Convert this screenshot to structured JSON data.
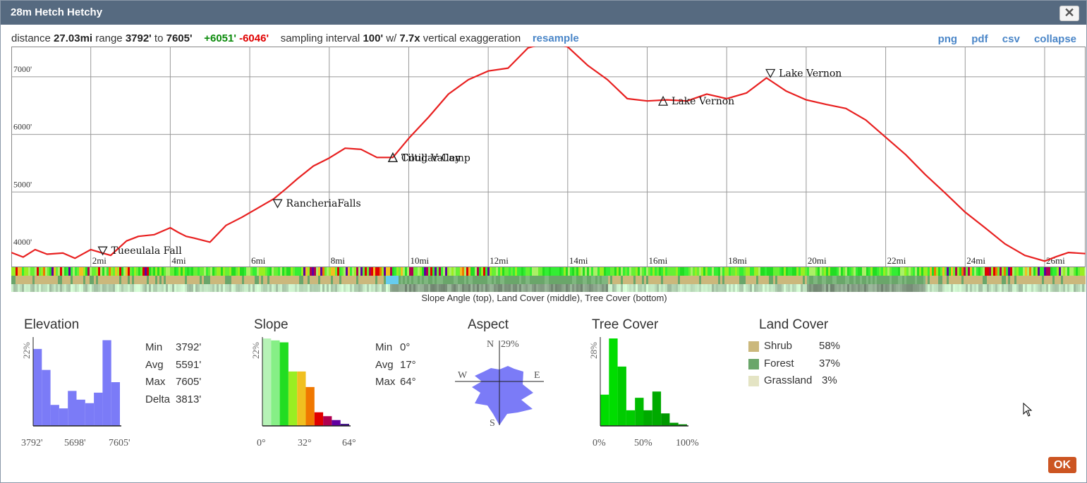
{
  "window": {
    "title": "28m Hetch Hetchy",
    "close_label": "✕"
  },
  "info": {
    "distance_label": "distance",
    "distance": "27.03mi",
    "range_label": "range",
    "range_min": "3792'",
    "to_label": "to",
    "range_max": "7605'",
    "gain": "+6051'",
    "loss": "-6046'",
    "sampling_label": "sampling interval",
    "interval": "100'",
    "w_label": "w/",
    "exaggeration": "7.7x",
    "exaggeration_label": "vertical exaggeration",
    "resample": "resample"
  },
  "links": [
    "png",
    "pdf",
    "csv",
    "collapse"
  ],
  "profile": {
    "y_ticks": [
      "4000'",
      "5000'",
      "6000'",
      "7000'"
    ],
    "x_ticks": [
      "2mi",
      "4mi",
      "6mi",
      "8mi",
      "10mi",
      "12mi",
      "14mi",
      "16mi",
      "18mi",
      "20mi",
      "22mi",
      "24mi",
      "26mi"
    ],
    "line_color": "#e82020",
    "caption": "Slope Angle (top), Land Cover (middle), Tree Cover (bottom)"
  },
  "chart_data": [
    {
      "type": "line",
      "title": "",
      "xlabel": "",
      "ylabel": "",
      "xlim": [
        0,
        27.03
      ],
      "ylim": [
        3792,
        7605
      ],
      "x": [
        0,
        0.3,
        0.6,
        0.9,
        1.3,
        1.6,
        2.0,
        2.2,
        2.5,
        2.9,
        3.2,
        3.6,
        4.0,
        4.2,
        4.4,
        4.6,
        5.0,
        5.4,
        5.8,
        6.2,
        6.6,
        6.9,
        7.2,
        7.6,
        8.0,
        8.4,
        8.8,
        9.2,
        9.6,
        10.0,
        10.5,
        11.0,
        11.5,
        12.0,
        12.5,
        13.0,
        13.5,
        14.0,
        14.5,
        15.0,
        15.5,
        16.0,
        16.5,
        17.0,
        17.5,
        18.0,
        18.5,
        19.0,
        19.5,
        20.0,
        20.5,
        21.0,
        21.5,
        22.0,
        22.5,
        23.0,
        23.5,
        24.0,
        24.5,
        25.0,
        25.5,
        26.0,
        26.3,
        26.6,
        27.03
      ],
      "y": [
        3950,
        3870,
        4000,
        3920,
        3940,
        3850,
        4000,
        3960,
        3900,
        4150,
        4230,
        4260,
        4380,
        4300,
        4230,
        4200,
        4130,
        4420,
        4560,
        4720,
        4880,
        5050,
        5230,
        5450,
        5590,
        5760,
        5740,
        5600,
        5600,
        5930,
        6300,
        6700,
        6950,
        7100,
        7150,
        7500,
        7600,
        7520,
        7200,
        6950,
        6620,
        6580,
        6600,
        6580,
        6700,
        6620,
        6720,
        6980,
        6750,
        6600,
        6520,
        6450,
        6250,
        5950,
        5650,
        5300,
        4980,
        4650,
        4380,
        4100,
        3900,
        3800,
        3880,
        3950,
        3930
      ]
    },
    {
      "type": "bar",
      "title": "Elevation",
      "categories": [
        "3792'",
        "",
        "",
        "",
        "5698'",
        "",
        "",
        "",
        "",
        "7605'"
      ],
      "values": [
        0.22,
        0.16,
        0.06,
        0.05,
        0.1,
        0.075,
        0.065,
        0.095,
        0.245,
        0.125
      ],
      "ylabel": "22%",
      "ylim": [
        0,
        0.25
      ],
      "color": "#7b7bf7"
    },
    {
      "type": "bar",
      "title": "Slope",
      "categories": [
        "0°",
        "",
        "",
        "",
        "32°",
        "",
        "",
        "",
        "",
        "64°"
      ],
      "values": [
        0.225,
        0.22,
        0.215,
        0.14,
        0.14,
        0.1,
        0.035,
        0.025,
        0.015,
        0.005
      ],
      "colors": [
        "#b6f2b6",
        "#86ef86",
        "#22dd22",
        "#99ee22",
        "#f0c020",
        "#f07800",
        "#e00000",
        "#b00050",
        "#6000a0",
        "#30007a"
      ],
      "ylabel": "22%",
      "ylim": [
        0,
        0.225
      ]
    },
    {
      "type": "bar",
      "title": "Tree Cover",
      "categories": [
        "0%",
        "",
        "",
        "",
        "50%",
        "",
        "",
        "",
        "",
        "100%"
      ],
      "values": [
        0.1,
        0.28,
        0.19,
        0.05,
        0.09,
        0.05,
        0.11,
        0.04,
        0.01,
        0.005
      ],
      "colors": [
        "#00dd00",
        "#00dd00",
        "#00cc00",
        "#00cc00",
        "#00bb00",
        "#00aa00",
        "#00aa00",
        "#009900",
        "#009900",
        "#008800"
      ],
      "ylabel": "28%",
      "ylim": [
        0,
        0.28
      ]
    }
  ],
  "profile_labels": [
    {
      "text": "Tueeulala Fall",
      "dir": "down"
    },
    {
      "text": "RancheriaFalls",
      "dir": "down"
    },
    {
      "text": "Tiltill Valley",
      "dir": "up"
    },
    {
      "text": "Cougar Camp",
      "dir": "up"
    },
    {
      "text": "Lake Vernon",
      "dir": "up"
    },
    {
      "text": "Lake Vernon",
      "dir": "down"
    }
  ],
  "elevation": {
    "title": "Elevation",
    "stats": [
      {
        "k": "Min",
        "v": "3792'"
      },
      {
        "k": "Avg",
        "v": "5591'"
      },
      {
        "k": "Max",
        "v": "7605'"
      },
      {
        "k": "Delta",
        "v": "3813'"
      }
    ],
    "y_label": "22%",
    "x_labels": [
      "3792'",
      "5698'",
      "7605'"
    ]
  },
  "slope": {
    "title": "Slope",
    "stats": [
      {
        "k": "Min",
        "v": "0°"
      },
      {
        "k": "Avg",
        "v": "17°"
      },
      {
        "k": "Max",
        "v": "64°"
      }
    ],
    "y_label": "22%",
    "x_labels": [
      "0°",
      "32°",
      "64°"
    ]
  },
  "aspect": {
    "title": "Aspect",
    "n": "N",
    "e": "E",
    "s": "S",
    "w": "W",
    "max": "29%"
  },
  "tree_cover": {
    "title": "Tree Cover",
    "y_label": "28%",
    "x_labels": [
      "0%",
      "50%",
      "100%"
    ]
  },
  "land_cover": {
    "title": "Land Cover",
    "items": [
      {
        "name": "Shrub",
        "pct": "58%",
        "color": "#cbb87c"
      },
      {
        "name": "Forest",
        "pct": "37%",
        "color": "#6aa66a"
      },
      {
        "name": "Grassland",
        "pct": "3%",
        "color": "#e4e4c4"
      }
    ]
  },
  "ok_label": "OK"
}
